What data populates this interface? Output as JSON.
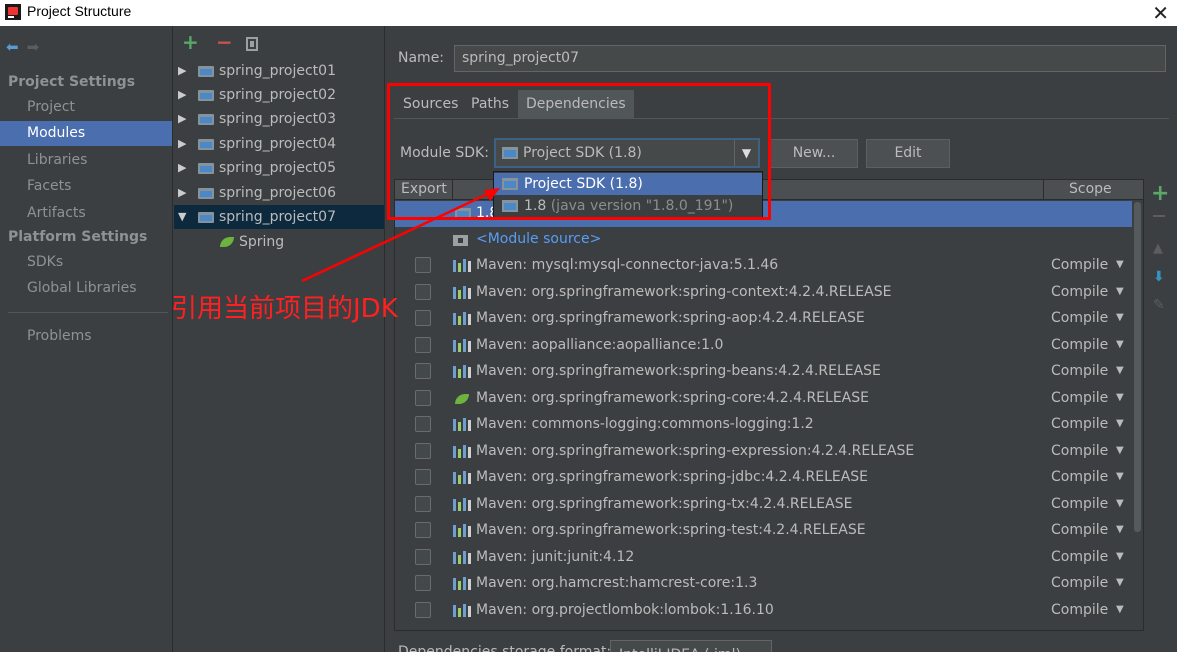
{
  "window": {
    "title": "Project Structure"
  },
  "left_panel": {
    "project_settings_title": "Project Settings",
    "project_settings": [
      "Project",
      "Modules",
      "Libraries",
      "Facets",
      "Artifacts"
    ],
    "platform_settings_title": "Platform Settings",
    "platform_settings": [
      "SDKs",
      "Global Libraries"
    ],
    "problems": "Problems",
    "selected": "Modules"
  },
  "tree": {
    "modules": [
      "spring_project01",
      "spring_project02",
      "spring_project03",
      "spring_project04",
      "spring_project05",
      "spring_project06",
      "spring_project07"
    ],
    "selected": "spring_project07",
    "child": "Spring"
  },
  "main": {
    "name_label": "Name:",
    "name_value": "spring_project07",
    "tabs": [
      "Sources",
      "Paths",
      "Dependencies"
    ],
    "active_tab": "Dependencies",
    "module_sdk_label": "Module SDK:",
    "module_sdk_value": "Project SDK (1.8)",
    "new_button": "New...",
    "edit_button": "Edit",
    "storage_label": "Dependencies storage format:",
    "storage_value": "IntelliJ IDEA (.iml)"
  },
  "sdk_dropdown": {
    "options": [
      {
        "label": "Project SDK (1.8)",
        "detail": ""
      },
      {
        "label": "1.8",
        "detail": "(java version \"1.8.0_191\")"
      }
    ],
    "selected_index": 0
  },
  "dependency_table": {
    "headers": {
      "export": "Export",
      "scope": "Scope"
    },
    "sdk_row": "1.8",
    "module_source": "<Module source>",
    "rows": [
      {
        "name": "Maven: mysql:mysql-connector-java:5.1.46",
        "scope": "Compile",
        "icon": "library-icon"
      },
      {
        "name": "Maven: org.springframework:spring-context:4.2.4.RELEASE",
        "scope": "Compile",
        "icon": "library-icon"
      },
      {
        "name": "Maven: org.springframework:spring-aop:4.2.4.RELEASE",
        "scope": "Compile",
        "icon": "library-icon"
      },
      {
        "name": "Maven: aopalliance:aopalliance:1.0",
        "scope": "Compile",
        "icon": "library-icon"
      },
      {
        "name": "Maven: org.springframework:spring-beans:4.2.4.RELEASE",
        "scope": "Compile",
        "icon": "library-icon"
      },
      {
        "name": "Maven: org.springframework:spring-core:4.2.4.RELEASE",
        "scope": "Compile",
        "icon": "spring-leaf-icon"
      },
      {
        "name": "Maven: commons-logging:commons-logging:1.2",
        "scope": "Compile",
        "icon": "library-icon"
      },
      {
        "name": "Maven: org.springframework:spring-expression:4.2.4.RELEASE",
        "scope": "Compile",
        "icon": "library-icon"
      },
      {
        "name": "Maven: org.springframework:spring-jdbc:4.2.4.RELEASE",
        "scope": "Compile",
        "icon": "library-icon"
      },
      {
        "name": "Maven: org.springframework:spring-tx:4.2.4.RELEASE",
        "scope": "Compile",
        "icon": "library-icon"
      },
      {
        "name": "Maven: org.springframework:spring-test:4.2.4.RELEASE",
        "scope": "Compile",
        "icon": "library-icon"
      },
      {
        "name": "Maven: junit:junit:4.12",
        "scope": "Compile",
        "icon": "library-icon"
      },
      {
        "name": "Maven: org.hamcrest:hamcrest-core:1.3",
        "scope": "Compile",
        "icon": "library-icon"
      },
      {
        "name": "Maven: org.projectlombok:lombok:1.16.10",
        "scope": "Compile",
        "icon": "library-icon"
      }
    ]
  },
  "annotation": {
    "text": "引用当前项目的JDK",
    "color": "#ff0000"
  },
  "colors": {
    "selection": "#4b6eaf",
    "background": "#3c3f41",
    "link": "#589df6"
  }
}
